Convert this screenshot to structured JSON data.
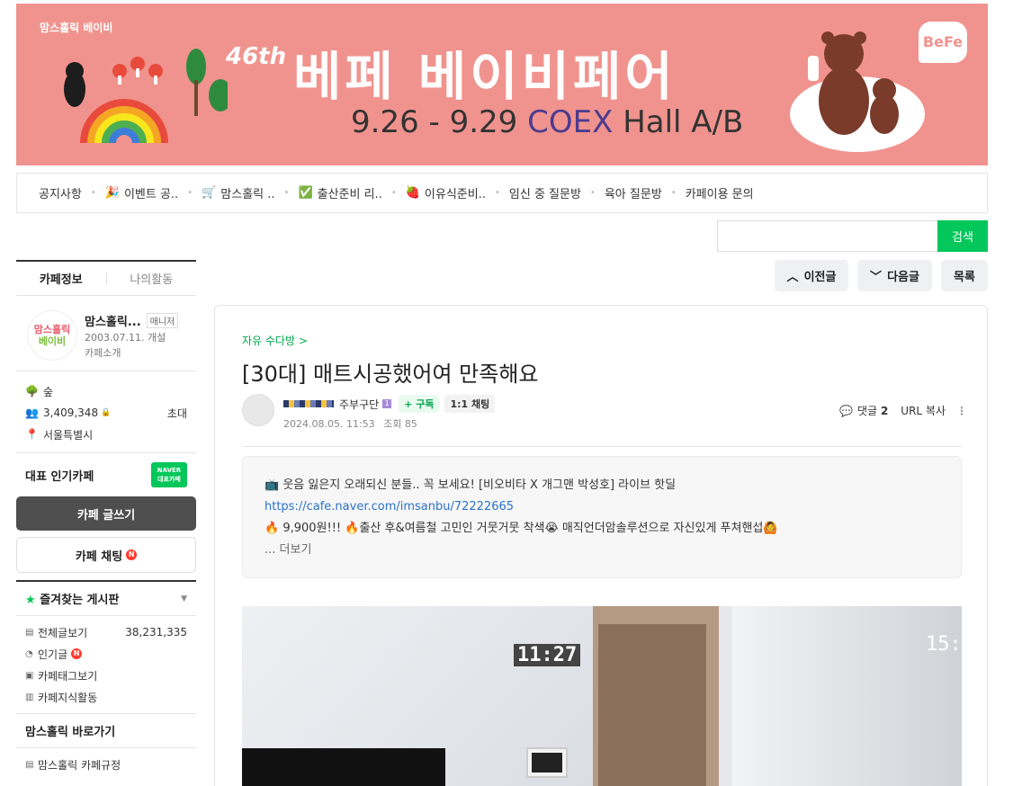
{
  "banner": {
    "brand": "맘스홀릭 베이비",
    "edition": "46th",
    "title": "베페 베이비페어",
    "dates": "9.26 - 9.29",
    "venue_coex": "COEX",
    "venue_hall": "Hall A/B",
    "logo": "BeFe",
    "bg_color": "#f0938e"
  },
  "menu": {
    "items": [
      {
        "label": "공지사항",
        "icon": ""
      },
      {
        "label": "이벤트 공..",
        "icon": "🎉"
      },
      {
        "label": "맘스홀릭 ..",
        "icon": "🛒"
      },
      {
        "label": "출산준비 리..",
        "icon": "✅"
      },
      {
        "label": "이유식준비..",
        "icon": "🍓"
      },
      {
        "label": "임신 중 질문방",
        "icon": ""
      },
      {
        "label": "육아 질문방",
        "icon": ""
      },
      {
        "label": "카페이용 문의",
        "icon": ""
      }
    ]
  },
  "search": {
    "button": "검색",
    "value": ""
  },
  "post_nav": {
    "prev": "이전글",
    "next": "다음글",
    "list": "목록"
  },
  "sidebar": {
    "tabs": [
      "카페정보",
      "나의활동"
    ],
    "cafe": {
      "logo_line1": "맘스홀릭",
      "logo_line2": "베이비",
      "name": "맘스홀릭...",
      "manager_badge": "매니저",
      "founded": "2003.07.11. 개설",
      "intro_link": "카페소개"
    },
    "stats": {
      "level": "숲",
      "members": "3,409,348",
      "invite": "초대",
      "location": "서울특별시"
    },
    "representative": "대표 인기카페",
    "naver_badge_line1": "NAVER",
    "naver_badge_line2": "대표카페",
    "write_button": "카페 글쓰기",
    "chat_button": "카페 채팅",
    "new_mark": "N",
    "favorites_title": "즐겨찾는 게시판",
    "board_items": [
      {
        "label": "전체글보기",
        "count": "38,231,335",
        "icon": "▤"
      },
      {
        "label": "인기글",
        "count": "",
        "icon": "◔",
        "new": "N"
      },
      {
        "label": "카페태그보기",
        "count": "",
        "icon": "▣"
      },
      {
        "label": "카페지식활동",
        "count": "",
        "icon": "▥"
      }
    ],
    "shortcut_title": "맘스홀릭 바로가기",
    "shortcut_items": [
      {
        "label": "맘스홀릭 카페규정",
        "icon": "▤"
      }
    ]
  },
  "article": {
    "board": "자유 수다방 >",
    "title": "[30대] 매트시공했어여 만족해요",
    "author": "주부구단",
    "level_badge": "1",
    "subscribe": "+ 구독",
    "chat11": "1:1 채팅",
    "date": "2024.08.05. 11:53",
    "views": "조회 85",
    "comments_label": "댓글",
    "comments_count": "2",
    "url_copy": "URL 복사",
    "notice_line1": "📺 웃음 잃은지 오래되신 분들.. 꼭 보세요! [비오비타 X 개그맨 박성호] 라이브 핫딜",
    "notice_link": "https://cafe.naver.com/imsanbu/72222665",
    "notice_line3": "🔥 9,900원!!! 🔥출산 후&여름철 고민인 거뭇거뭇 착색😭 매직언더암솔루션으로 자신있게 푸쳐핸섭🙆",
    "notice_more": "... 더보기",
    "clock_text": "11:27",
    "clock2_text": "15:"
  },
  "colors": {
    "accent": "#03c75a",
    "link": "#2a71c9",
    "new": "#ff3b30"
  }
}
